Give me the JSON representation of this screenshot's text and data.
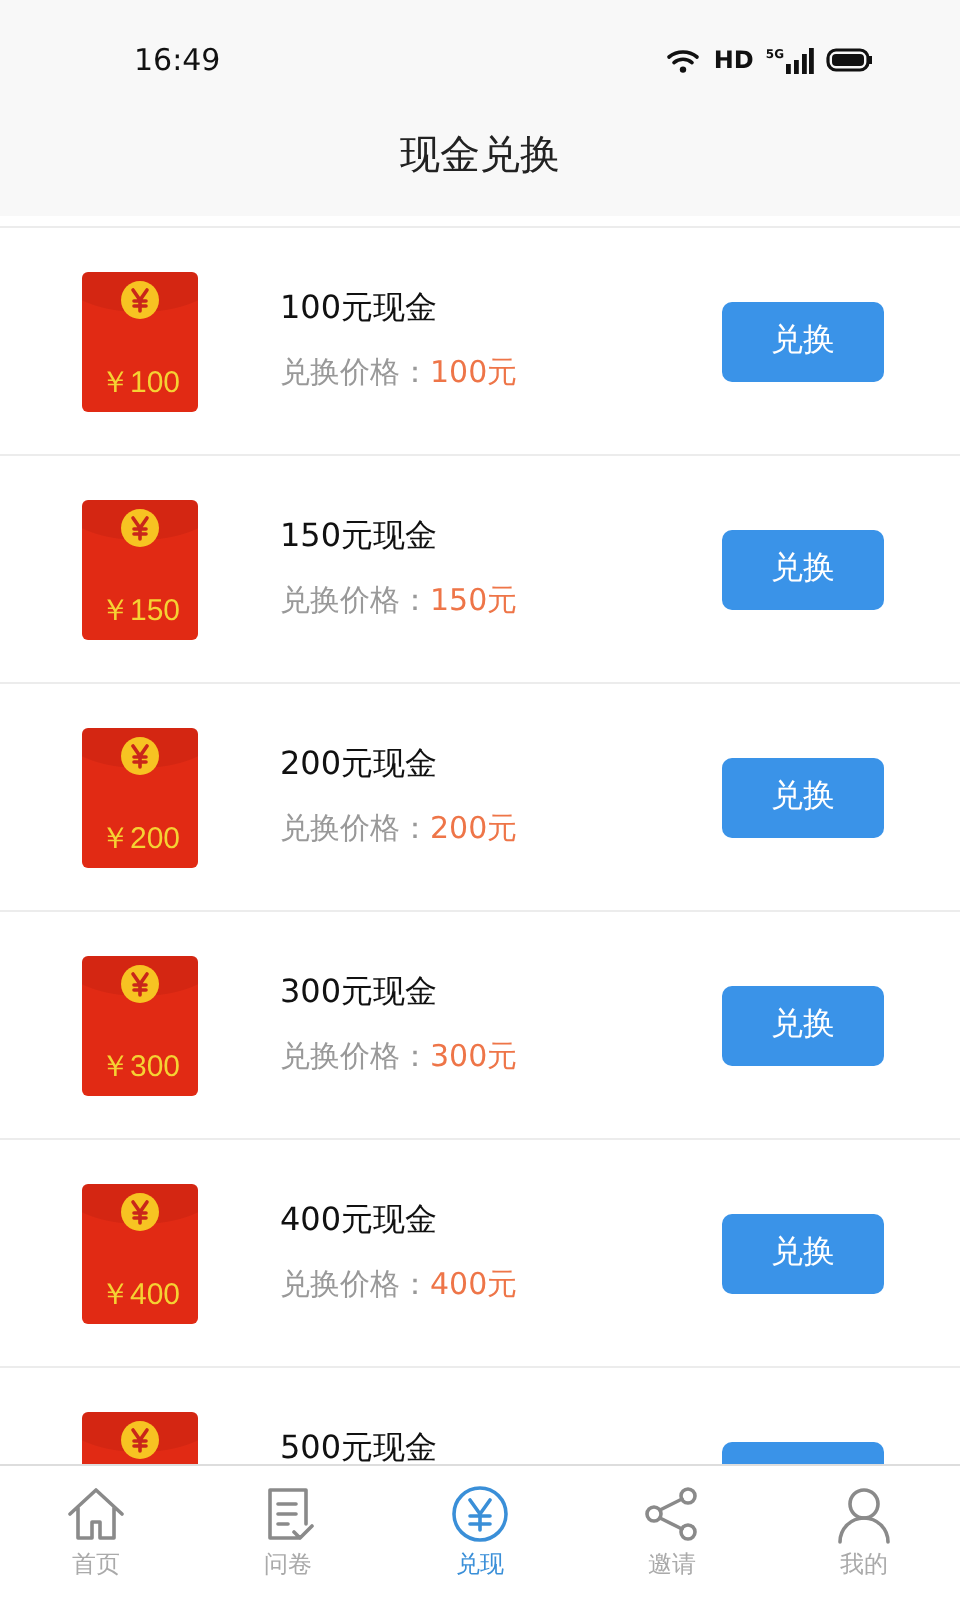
{
  "status_bar": {
    "time": "16:49",
    "network": "HD",
    "signal": "5G"
  },
  "header": {
    "title": "现金兑换"
  },
  "items": [
    {
      "amount": "￥100",
      "title": "100元现金",
      "price_label": "兑换价格：",
      "price": "100元",
      "button": "兑换"
    },
    {
      "amount": "￥150",
      "title": "150元现金",
      "price_label": "兑换价格：",
      "price": "150元",
      "button": "兑换"
    },
    {
      "amount": "￥200",
      "title": "200元现金",
      "price_label": "兑换价格：",
      "price": "200元",
      "button": "兑换"
    },
    {
      "amount": "￥300",
      "title": "300元现金",
      "price_label": "兑换价格：",
      "price": "300元",
      "button": "兑换"
    },
    {
      "amount": "￥400",
      "title": "400元现金",
      "price_label": "兑换价格：",
      "price": "400元",
      "button": "兑换"
    },
    {
      "title": "500元现金"
    }
  ],
  "tabs": [
    {
      "kind": "home",
      "label": "首页",
      "selected": false
    },
    {
      "kind": "survey",
      "label": "问卷",
      "selected": false
    },
    {
      "kind": "exchange",
      "label": "兑现",
      "selected": true
    },
    {
      "kind": "share",
      "label": "邀请",
      "selected": false
    },
    {
      "kind": "profile",
      "label": "我的",
      "selected": false
    }
  ]
}
